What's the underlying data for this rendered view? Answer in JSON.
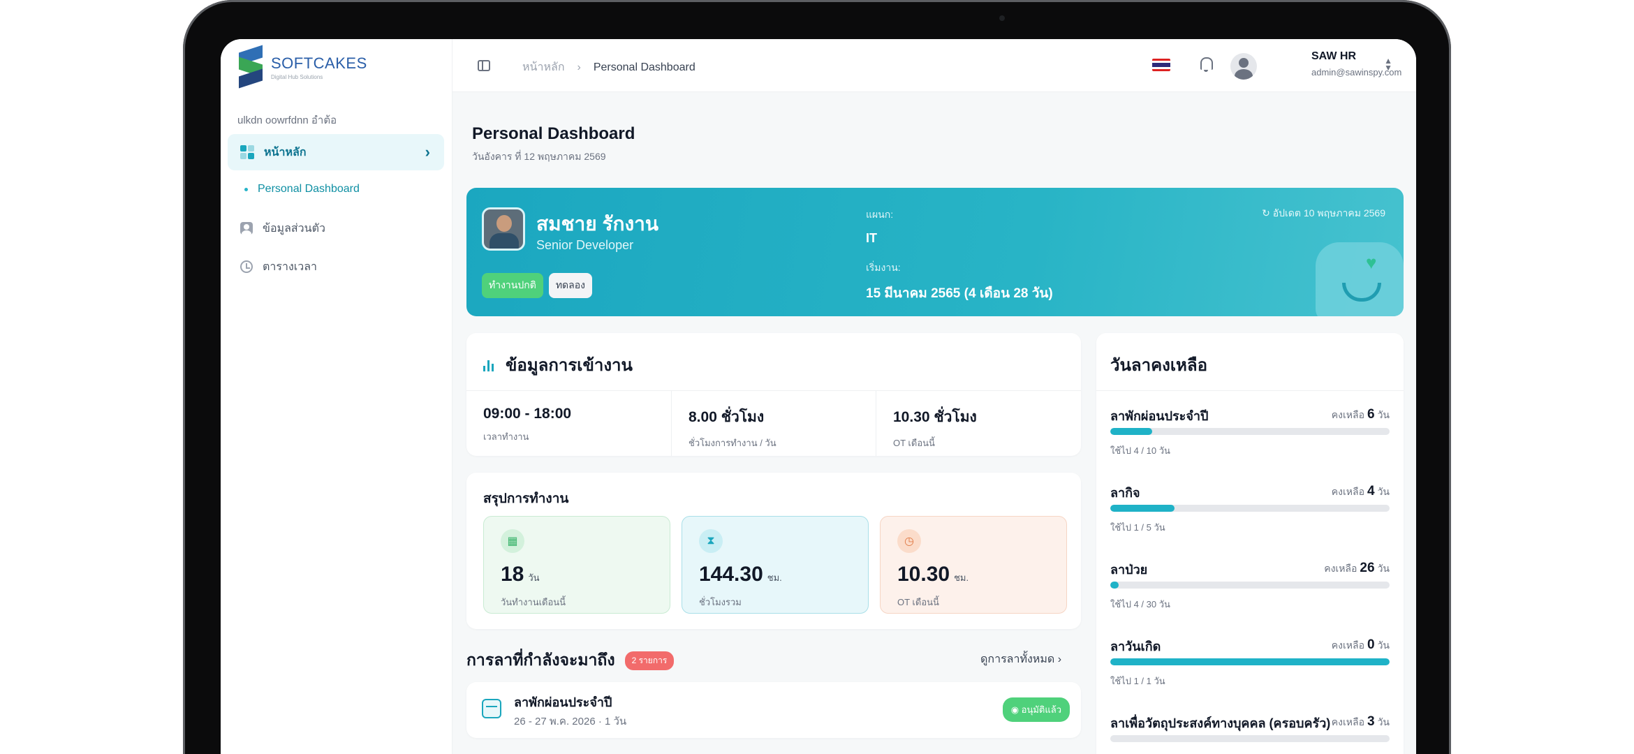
{
  "app": {
    "logo_name": "SOFTCAKES",
    "logo_tagline": "Digital Hub Solutions"
  },
  "sidebar": {
    "section_label": "ulkdn oowrfdnn อำต้อ",
    "items": [
      {
        "label": "หน้าหลัก",
        "active": true
      },
      {
        "label": "Personal Dashboard",
        "sub": true
      },
      {
        "label": "ข้อมูลส่วนตัว"
      },
      {
        "label": "ตารางเวลา"
      }
    ]
  },
  "topbar": {
    "breadcrumb_home": "หน้าหลัก",
    "breadcrumb_sep": "›",
    "breadcrumb_current": "Personal Dashboard",
    "user_name": "SAW HR",
    "user_email": "admin@sawinspy.com"
  },
  "page": {
    "title": "Personal Dashboard",
    "date": "วันอังคาร ที่ 12 พฤษภาคม 2569"
  },
  "profile": {
    "name": "สมชาย รักงาน",
    "role": "Senior Developer",
    "badge_status": "ทำงานปกติ",
    "badge_type": "ทดลอง",
    "dept_label": "แผนก:",
    "dept_value": "IT",
    "start_label": "เริ่มงาน:",
    "start_value": "15 มีนาคม 2565 (4 เดือน 28 วัน)",
    "updated": "↻ อัปเดต 10 พฤษภาคม 2569"
  },
  "attendance": {
    "title": "ข้อมูลการเข้างาน",
    "items": [
      {
        "value": "09:00 - 18:00",
        "label": "เวลาทำงาน"
      },
      {
        "value": "8.00 ชั่วโมง",
        "label": "ชั่วโมงการทำงาน / วัน"
      },
      {
        "value": "10.30 ชั่วโมง",
        "label": "OT เดือนนี้"
      }
    ]
  },
  "summary": {
    "title": "สรุปการทำงาน",
    "stats": [
      {
        "value": "18",
        "unit": "วัน",
        "label": "วันทำงานเดือนนี้",
        "icon": "calendar-icon"
      },
      {
        "value": "144.30",
        "unit": "ชม.",
        "label": "ชั่วโมงรวม",
        "icon": "hourglass-icon"
      },
      {
        "value": "10.30",
        "unit": "ชม.",
        "label": "OT เดือนนี้",
        "icon": "stopwatch-icon"
      }
    ]
  },
  "upcoming": {
    "title": "การลาที่กำลังจะมาถึง",
    "count_badge": "2 รายการ",
    "link": "ดูการลาทั้งหมด ›",
    "items": [
      {
        "name": "ลาพักผ่อนประจำปี",
        "date": "26 - 27 พ.ค. 2026 · 1 วัน",
        "status": "◉ อนุมัติแล้ว"
      }
    ]
  },
  "leave_balance": {
    "title": "วันลาคงเหลือ",
    "items": [
      {
        "name": "ลาพักผ่อนประจำปี",
        "remaining_label": "คงเหลือ",
        "remaining": "6",
        "unit": "วัน",
        "used": "ใช้ไป 4 / 10 วัน",
        "fraction": 0.15
      },
      {
        "name": "ลากิจ",
        "remaining_label": "คงเหลือ",
        "remaining": "4",
        "unit": "วัน",
        "used": "ใช้ไป 1 / 5 วัน",
        "fraction": 0.23
      },
      {
        "name": "ลาป่วย",
        "remaining_label": "คงเหลือ",
        "remaining": "26",
        "unit": "วัน",
        "used": "ใช้ไป 4 / 30 วัน",
        "fraction": 0.03
      },
      {
        "name": "ลาวันเกิด",
        "remaining_label": "คงเหลือ",
        "remaining": "0",
        "unit": "วัน",
        "used": "ใช้ไป 1 / 1 วัน",
        "fraction": 1.0
      },
      {
        "name": "ลาเพื่อวัตถุประสงค์ทางบุคคล (ครอบครัว)",
        "remaining_label": "คงเหลือ",
        "remaining": "3",
        "unit": "วัน",
        "used": "",
        "fraction": 0.0
      }
    ]
  },
  "colors": {
    "accent": "#1aa6bd",
    "hero_start": "#1ba7c0",
    "success": "#4fd17b",
    "danger": "#f26b6b"
  }
}
